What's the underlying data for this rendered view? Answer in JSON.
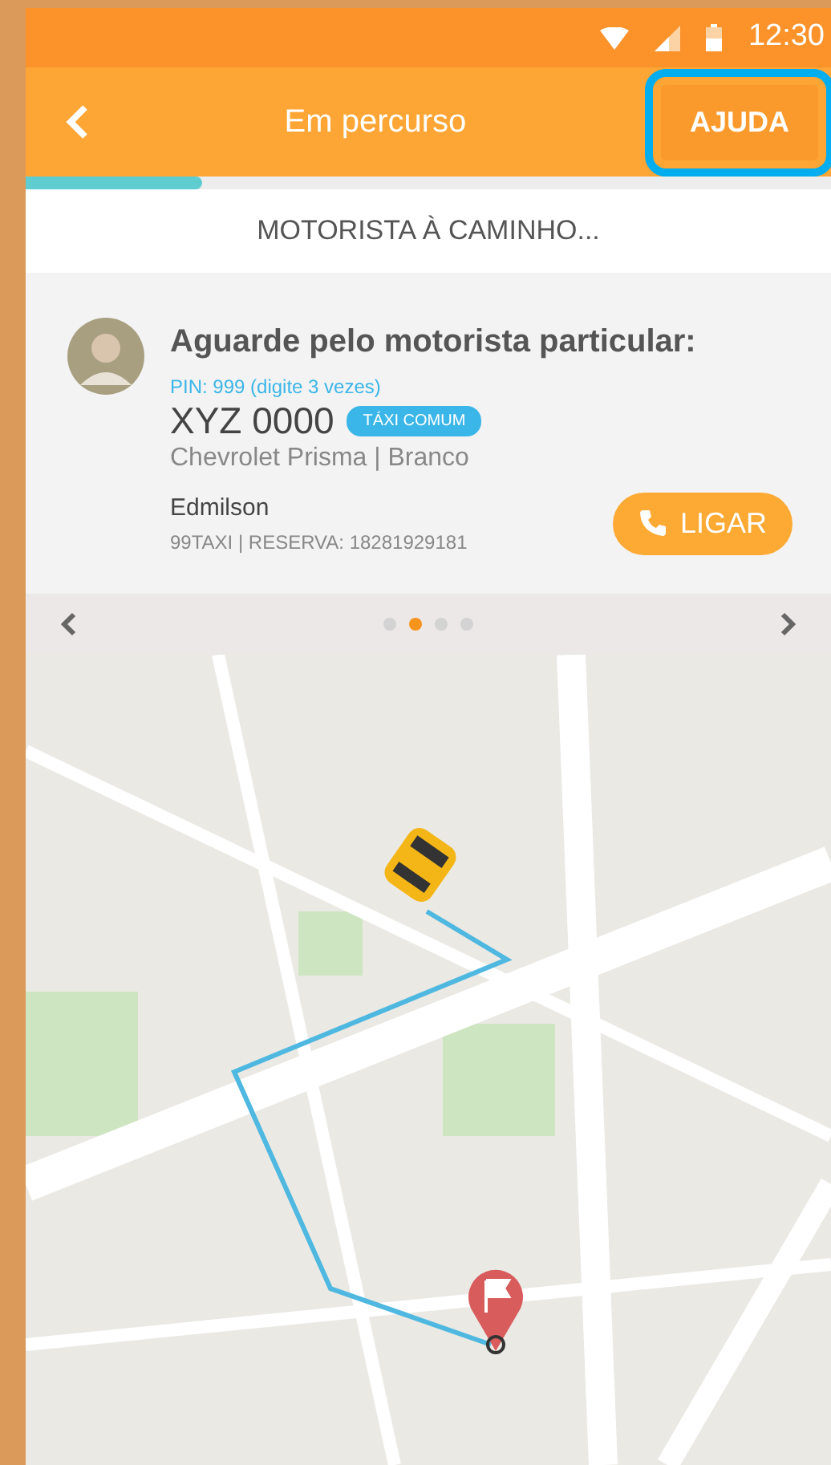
{
  "status_bar": {
    "time": "12:30"
  },
  "app_bar": {
    "title": "Em percurso",
    "help_button": {
      "label": "AJUDA",
      "highlighted": true
    }
  },
  "progress": {
    "level": 0.22
  },
  "status_header": "MOTORISTA À CAMINHO...",
  "driver_card": {
    "heading": "Aguarde pelo motorista particular:",
    "pin": "PIN: 999 (digite 3 vezes)",
    "plate": "XYZ 0000",
    "tag": "TÁXI COMUM",
    "car": "Chevrolet Prisma | Branco",
    "driver_name": "Edmilson",
    "reservation": "99TAXI | RESERVA: 18281929181",
    "call_button": "LIGAR"
  },
  "pager": [
    {
      "selected": false
    },
    {
      "selected": true
    },
    {
      "selected": false
    },
    {
      "selected": false
    }
  ]
}
